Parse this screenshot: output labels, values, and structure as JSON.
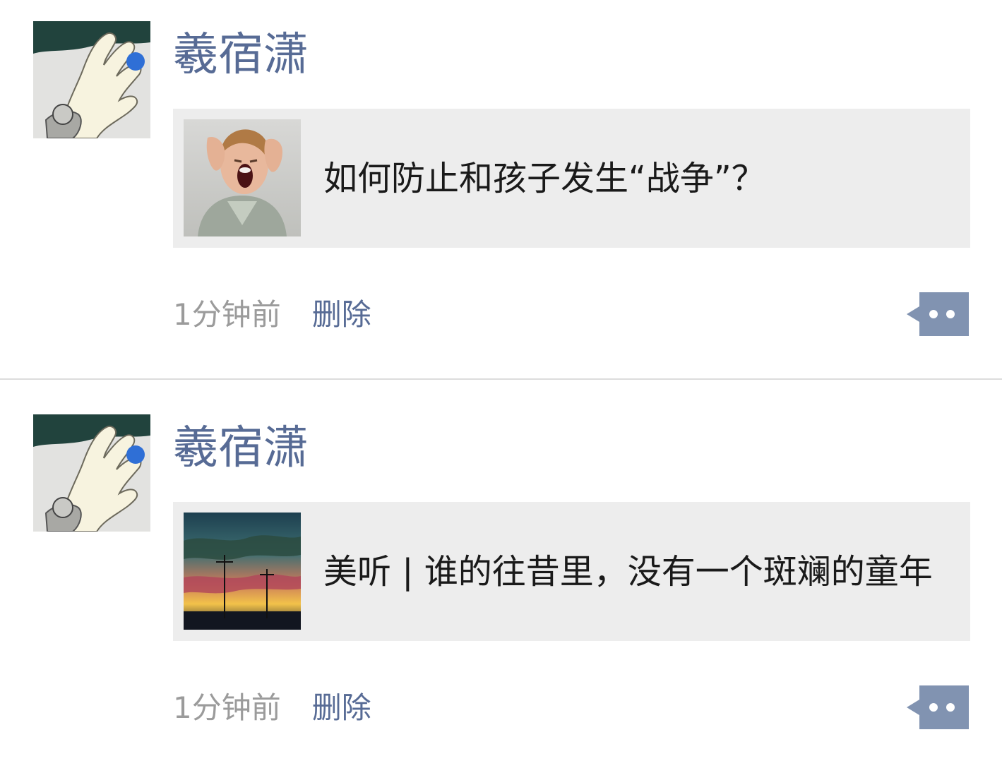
{
  "posts": [
    {
      "author": "羲宿潇",
      "avatar_icon": "hand-holding-blue-dot-avatar",
      "share": {
        "thumb_icon": "screaming-boy-thumbnail",
        "title": "如何防止和孩子发生“战争”？"
      },
      "time": "1分钟前",
      "delete_label": "删除",
      "comment_icon": "comment-bubble-icon"
    },
    {
      "author": "羲宿潇",
      "avatar_icon": "hand-holding-blue-dot-avatar",
      "share": {
        "thumb_icon": "sunset-sky-thumbnail",
        "title": "美听 | 谁的往昔里，没有一个斑斓的童年"
      },
      "time": "1分钟前",
      "delete_label": "删除",
      "comment_icon": "comment-bubble-icon"
    }
  ],
  "colors": {
    "link": "#576b95",
    "meta": "#9b9b9b",
    "card_bg": "#ededed",
    "divider": "#dcdcdc"
  }
}
